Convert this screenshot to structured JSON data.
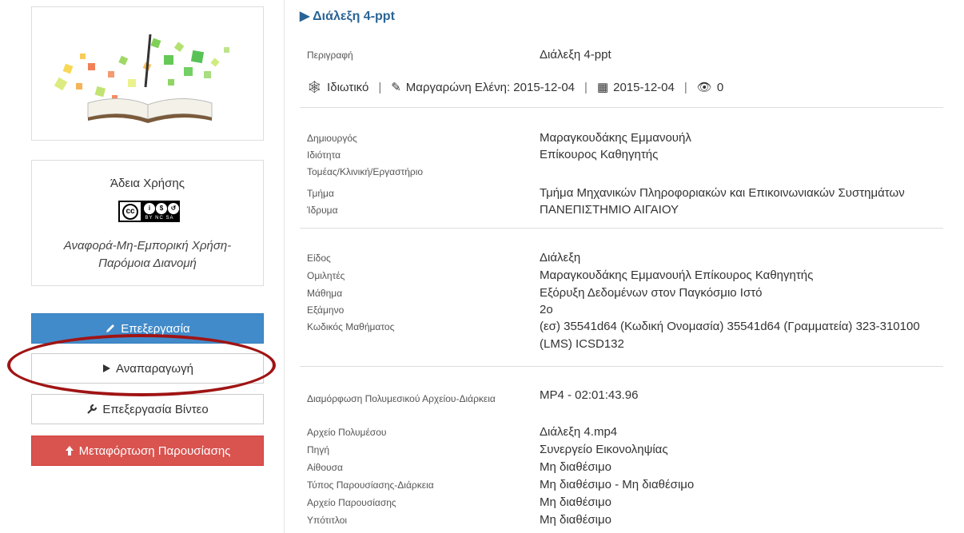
{
  "lecture_title": "Διάλεξη 4-ppt",
  "description": {
    "label": "Περιγραφή",
    "value": "Διάλεξη 4-ppt"
  },
  "meta": {
    "visibility": "Ιδιωτικό",
    "editor": "Μαργαρώνη Ελένη: 2015-12-04",
    "date": "2015-12-04",
    "views": "0"
  },
  "license": {
    "title": "Άδεια Χρήσης",
    "badge_text": "BY NC SA",
    "name": "Αναφορά-Μη-Εμπορική Χρήση-Παρόμοια Διανομή"
  },
  "buttons": {
    "edit": "Επεξεργασία",
    "play": "Αναπαραγωγή",
    "edit_video": "Επεξεργασία Βίντεο",
    "upload": "Μεταφόρτωση Παρουσίασης"
  },
  "creator_section": [
    {
      "label": "Δημιουργός",
      "value": "Μαραγκουδάκης Εμμανουήλ"
    },
    {
      "label": "Ιδιότητα",
      "value": "Επίκουρος Καθηγητής"
    },
    {
      "label": "Τομέας/Κλινική/Εργαστήριο",
      "value": ""
    },
    {
      "label": "Τμήμα",
      "value": "Τμήμα Μηχανικών Πληροφοριακών και Επικοινωνιακών Συστημάτων"
    },
    {
      "label": "Ίδρυμα",
      "value": "ΠΑΝΕΠΙΣΤΗΜΙΟ ΑΙΓΑΙΟΥ"
    }
  ],
  "course_section": [
    {
      "label": "Είδος",
      "value": "Διάλεξη"
    },
    {
      "label": "Ομιλητές",
      "value": "Μαραγκουδάκης Εμμανουήλ Επίκουρος Καθηγητής"
    },
    {
      "label": "Μάθημα",
      "value": "Εξόρυξη Δεδομένων στον Παγκόσμιο Ιστό"
    },
    {
      "label": "Εξάμηνο",
      "value": "2ο"
    },
    {
      "label": "Κωδικός Μαθήματος",
      "value": "(εσ) 35541d64  (Κωδική Ονομασία) 35541d64  (Γραμματεία)  323-310100  (LMS)  ICSD132"
    }
  ],
  "media_section": [
    {
      "label": "Διαμόρφωση Πολυμεσικού Αρχείου-Διάρκεια",
      "value": "MP4 - 02:01:43.96"
    },
    {
      "label": "Αρχείο Πολυμέσου",
      "value": "Διάλεξη 4.mp4"
    },
    {
      "label": "Πηγή",
      "value": "Συνεργείο Εικονοληψίας"
    },
    {
      "label": "Αίθουσα",
      "value": "Μη διαθέσιμο"
    },
    {
      "label": "Τύπος Παρουσίασης-Διάρκεια",
      "value": "Μη διαθέσιμο - Μη διαθέσιμο"
    },
    {
      "label": "Αρχείο Παρουσίασης",
      "value": "Μη διαθέσιμο"
    },
    {
      "label": "Υπότιτλοι",
      "value": "Μη διαθέσιμο"
    }
  ],
  "colors": {
    "title_blue": "#2a6496",
    "edit_button": "#428bca",
    "upload_button": "#d9534f",
    "highlight_ellipse": "#a01414"
  }
}
